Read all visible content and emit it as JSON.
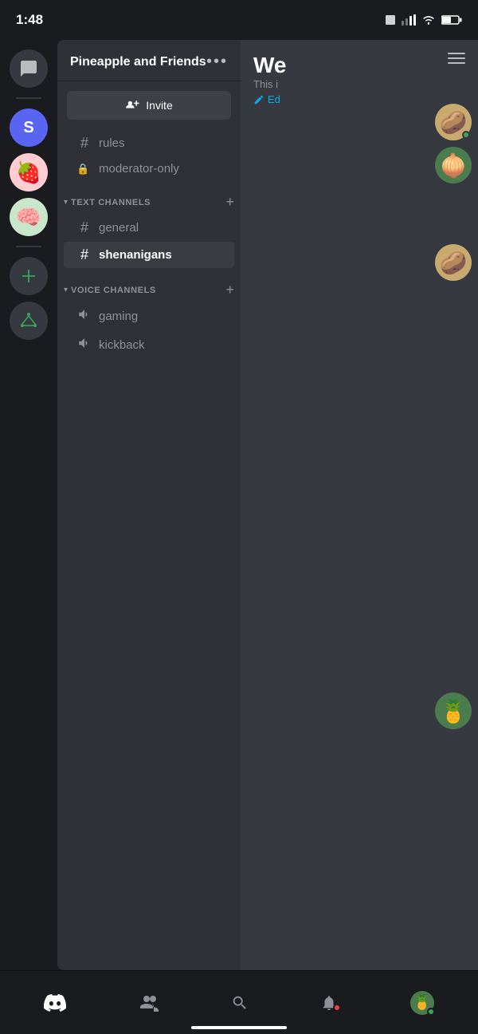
{
  "statusBar": {
    "time": "1:48",
    "battery": "50"
  },
  "serverSidebar": {
    "items": [
      {
        "id": "chat",
        "label": "Chat icon",
        "type": "chat"
      },
      {
        "id": "s",
        "label": "S server",
        "type": "letter",
        "letter": "S"
      },
      {
        "id": "strawberry",
        "label": "Strawberry server",
        "type": "emoji",
        "emoji": "🍓"
      },
      {
        "id": "green-brain",
        "label": "Green brain server",
        "type": "emoji",
        "emoji": "🧠"
      },
      {
        "id": "add",
        "label": "Add server",
        "type": "add",
        "symbol": "+"
      },
      {
        "id": "directory",
        "label": "Directory",
        "type": "tree"
      }
    ]
  },
  "channelPanel": {
    "serverName": "Pineapple and Friends",
    "moreButtonLabel": "•••",
    "inviteLabel": "Invite",
    "channels": [
      {
        "id": "rules",
        "name": "rules",
        "type": "text",
        "active": false
      },
      {
        "id": "moderator-only",
        "name": "moderator-only",
        "type": "locked",
        "active": false
      }
    ],
    "categories": [
      {
        "id": "text-channels",
        "label": "TEXT CHANNELS",
        "channels": [
          {
            "id": "general",
            "name": "general",
            "type": "text",
            "active": false
          },
          {
            "id": "shenanigans",
            "name": "shenanigans",
            "type": "text",
            "active": true
          }
        ]
      },
      {
        "id": "voice-channels",
        "label": "VOICE CHANNELS",
        "channels": [
          {
            "id": "gaming",
            "name": "gaming",
            "type": "voice",
            "active": false
          },
          {
            "id": "kickback",
            "name": "kickback",
            "type": "voice",
            "active": false
          }
        ]
      }
    ]
  },
  "rightPanel": {
    "welcomeTitle": "We",
    "welcomeSubtitle": "This i",
    "editLabel": "Ed",
    "avatars": [
      "🥔",
      "🧅",
      "🥔",
      "🍍"
    ]
  },
  "bottomNav": {
    "items": [
      {
        "id": "discord",
        "label": "Discord home",
        "icon": "discord"
      },
      {
        "id": "friends",
        "label": "Friends",
        "icon": "friends"
      },
      {
        "id": "search",
        "label": "Search",
        "icon": "search"
      },
      {
        "id": "notifications",
        "label": "Notifications",
        "icon": "bell",
        "hasNotification": true
      },
      {
        "id": "profile",
        "label": "Profile",
        "icon": "avatar",
        "emoji": "🍍"
      }
    ]
  }
}
